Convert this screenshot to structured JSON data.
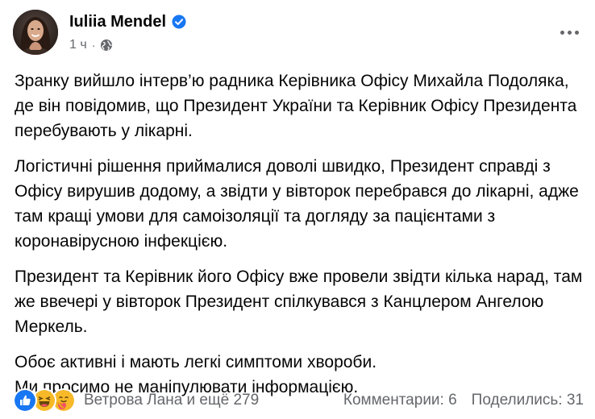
{
  "post": {
    "author": "Iuliia Mendel",
    "timestamp": "1 ч",
    "separator": "·",
    "icons": {
      "verified": "verified-badge-icon",
      "audience": "globe-icon",
      "more": "more-options-icon"
    },
    "paragraphs": [
      "Зранку вийшло інтерв’ю радника Керівника Офісу Михайла Подоляка, де він повідомив, що Президент України та Керівник Офісу Президента перебувають у лікарні.",
      "Логістичні рішення приймалися доволі швидко, Президент справді з Офісу вирушив додому, а звідти у вівторок перебрався до лікарні, адже там кращі умови для самоізоляції та догляду за пацієнтами з коронавірусною інфекцією.",
      "Президент та Керівник його Офісу вже провели звідти кілька нарад, там же ввечері у вівторок Президент спілкувався з Канцлером Ангелою Меркель.",
      "Обоє активні і мають легкі симптоми хвороби.\nМи просимо не маніпулювати інформацією."
    ]
  },
  "footer": {
    "reactions": {
      "icons": [
        "like-reaction-icon",
        "haha-reaction-icon",
        "care-reaction-icon"
      ],
      "summary": "Ветрова Лана и ещё 279"
    },
    "comments": "Комментарии: 6",
    "shares": "Поделились: 31"
  },
  "colors": {
    "text_primary": "#050505",
    "text_secondary": "#65676b",
    "verified_blue": "#1877f2",
    "like_blue": "#1877f2",
    "haha_yellow": "#f7b928"
  }
}
